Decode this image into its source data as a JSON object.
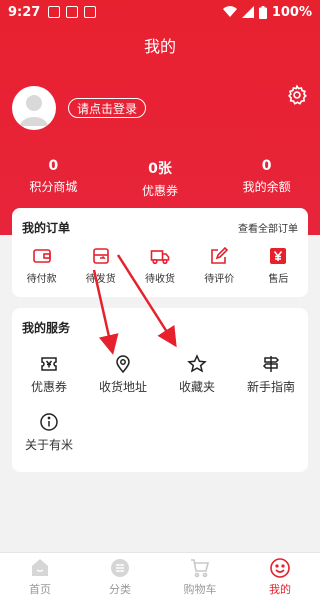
{
  "status": {
    "time": "9:27",
    "battery": "100%"
  },
  "header": {
    "title": "我的",
    "login_label": "请点击登录"
  },
  "stats": [
    {
      "value": "0",
      "label": "积分商城"
    },
    {
      "value": "0张",
      "label": "优惠券"
    },
    {
      "value": "0",
      "label": "我的余额"
    }
  ],
  "orders": {
    "title": "我的订单",
    "view_all": "查看全部订单",
    "items": [
      {
        "label": "待付款",
        "icon": "wallet-icon"
      },
      {
        "label": "待发货",
        "icon": "truck-box-icon"
      },
      {
        "label": "待收货",
        "icon": "delivery-truck-icon"
      },
      {
        "label": "待评价",
        "icon": "edit-icon"
      },
      {
        "label": "售后",
        "icon": "yen-icon"
      }
    ]
  },
  "services": {
    "title": "我的服务",
    "items": [
      {
        "label": "优惠券",
        "icon": "coupon-icon"
      },
      {
        "label": "收货地址",
        "icon": "location-icon"
      },
      {
        "label": "收藏夹",
        "icon": "star-icon"
      },
      {
        "label": "新手指南",
        "icon": "signpost-icon"
      },
      {
        "label": "关于有米",
        "icon": "info-icon"
      }
    ]
  },
  "tabs": [
    {
      "label": "首页",
      "icon": "home-icon"
    },
    {
      "label": "分类",
      "icon": "category-icon"
    },
    {
      "label": "购物车",
      "icon": "cart-icon"
    },
    {
      "label": "我的",
      "icon": "smile-icon",
      "active": true
    }
  ],
  "colors": {
    "brand": "#e6212d",
    "background": "#f2f2f2"
  }
}
